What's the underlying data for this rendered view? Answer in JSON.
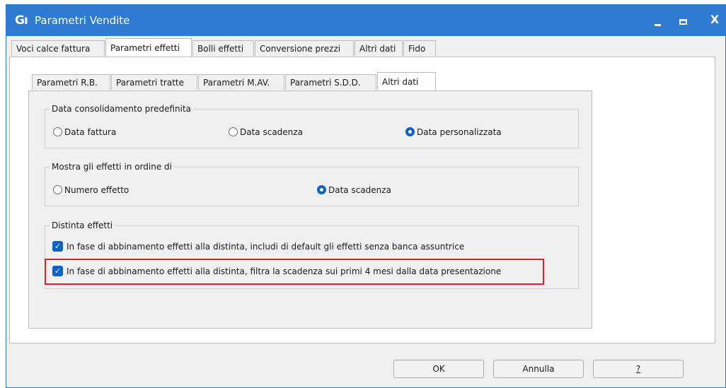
{
  "window": {
    "logo": "Gı",
    "title": "Parametri Vendite",
    "minimize_icon": "minimize-icon",
    "maximize_icon": "maximize-icon",
    "close_glyph": "X",
    "accent_color": "#2f7ad3"
  },
  "outer_tabs": [
    {
      "label": "Voci calce fattura",
      "active": false
    },
    {
      "label": "Parametri effetti",
      "active": true
    },
    {
      "label": "Bolli effetti",
      "active": false
    },
    {
      "label": "Conversione prezzi",
      "active": false
    },
    {
      "label": "Altri dati",
      "active": false
    },
    {
      "label": "Fido",
      "active": false
    }
  ],
  "inner_tabs": [
    {
      "label": "Parametri R.B.",
      "active": false
    },
    {
      "label": "Parametri tratte",
      "active": false
    },
    {
      "label": "Parametri M.AV.",
      "active": false
    },
    {
      "label": "Parametri S.D.D.",
      "active": false
    },
    {
      "label": "Altri dati",
      "active": true
    }
  ],
  "group_consolidamento": {
    "legend": "Data consolidamento predefinita",
    "options": [
      {
        "label": "Data fattura",
        "checked": false
      },
      {
        "label": "Data scadenza",
        "checked": false
      },
      {
        "label": "Data personalizzata",
        "checked": true
      }
    ]
  },
  "group_ordine": {
    "legend": "Mostra gli effetti in ordine di",
    "options": [
      {
        "label": "Numero effetto",
        "checked": false
      },
      {
        "label": "Data scadenza",
        "checked": true
      }
    ]
  },
  "group_distinta": {
    "legend": "Distinta effetti",
    "checkboxes": [
      {
        "label": "In fase di abbinamento effetti alla distinta, includi di default gli effetti senza banca assuntrice",
        "checked": true
      },
      {
        "label": "In fase di abbinamento effetti alla distinta, filtra la scadenza sui primi 4 mesi dalla data presentazione",
        "checked": true
      }
    ],
    "highlight_color": "#e02020"
  },
  "buttons": {
    "ok": "OK",
    "annulla": "Annulla",
    "help": "?"
  }
}
